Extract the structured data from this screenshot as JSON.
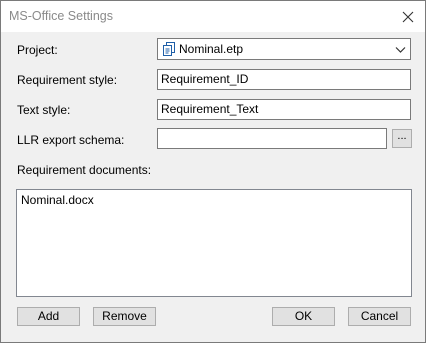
{
  "window": {
    "title": "MS-Office Settings",
    "close_icon": "close-icon"
  },
  "form": {
    "project": {
      "label": "Project:",
      "value": "Nominal.etp",
      "icon": "document-icon",
      "dropdown_icon": "chevron-down-icon"
    },
    "requirement_style": {
      "label": "Requirement style:",
      "value": "Requirement_ID"
    },
    "text_style": {
      "label": "Text style:",
      "value": "Requirement_Text"
    },
    "llr_export_schema": {
      "label": "LLR export schema:",
      "value": "",
      "browse_label": "..."
    },
    "requirement_documents": {
      "label": "Requirement documents:",
      "items": [
        "Nominal.docx"
      ]
    }
  },
  "buttons": {
    "add": "Add",
    "remove": "Remove",
    "ok": "OK",
    "cancel": "Cancel"
  }
}
